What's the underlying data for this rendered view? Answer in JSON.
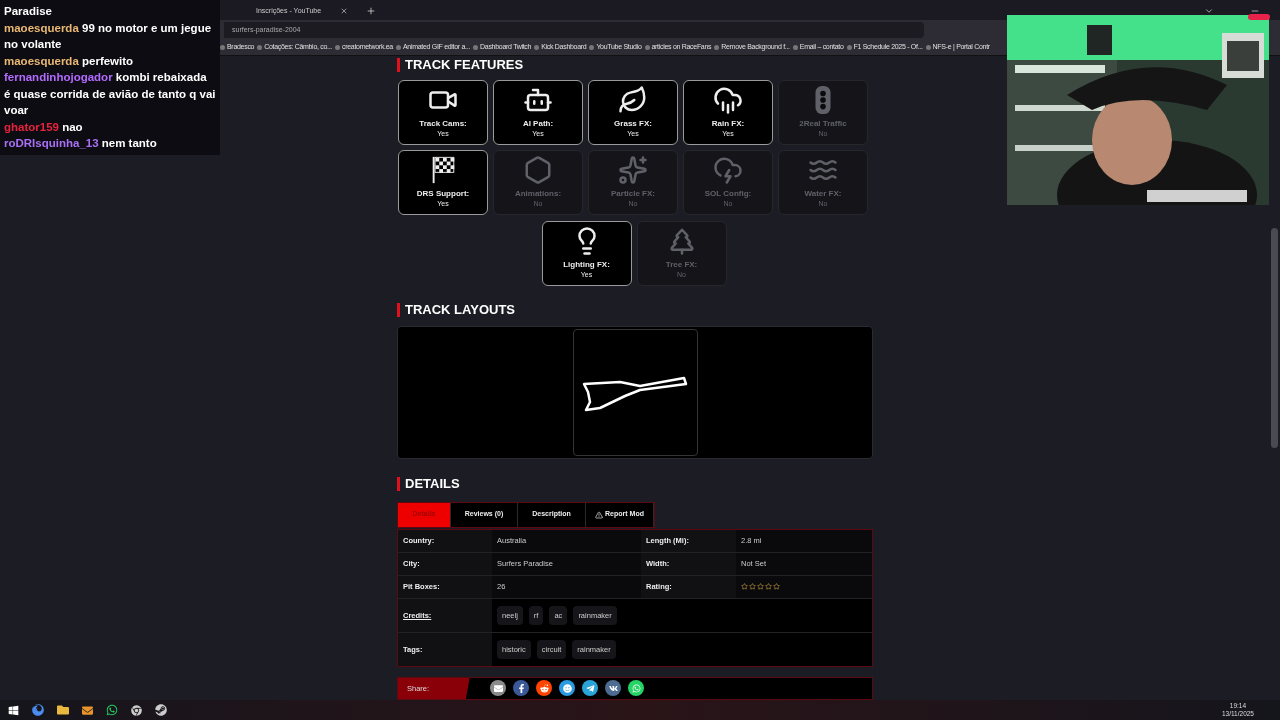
{
  "browser": {
    "tabs": [
      {
        "title": "Inscrições - YouTube",
        "selected": false
      }
    ],
    "address": "surfers-paradise-2004",
    "bookmarks": [
      "Bradesco",
      "Cotações: Câmbio, co...",
      "creatornetwork.ea",
      "Animated GIF editor a...",
      "Dashboard Twitch",
      "Kick Dashboard",
      "YouTube Studio",
      "articles on RaceFans",
      "Remove Background f...",
      "Email – contato",
      "F1 Schedule 2025 - Of...",
      "NFS-e | Portal Contr"
    ]
  },
  "chat": {
    "lead": "Paradise",
    "messages": [
      {
        "user": "maoesquerda",
        "color": "#e9b872",
        "text": "99 no motor e um jegue no volante"
      },
      {
        "user": "maoesquerda",
        "color": "#e9b872",
        "text": "perfewito"
      },
      {
        "user": "fernandinhojogador",
        "color": "#b36bff",
        "text": "kombi rebaixada é quase corrida de avião de tanto q vai voar"
      },
      {
        "user": "ghator159",
        "color": "#e8223d",
        "text": "nao"
      },
      {
        "user": "roDRIsquinha_13",
        "color": "#a970f5",
        "text": "nem tanto"
      }
    ]
  },
  "features": {
    "title": "TRACK FEATURES",
    "items": [
      {
        "kind": "camera",
        "label": "Track Cams:",
        "value": "Yes",
        "enabled": true
      },
      {
        "kind": "robot",
        "label": "AI Path:",
        "value": "Yes",
        "enabled": true
      },
      {
        "kind": "leaf",
        "label": "Grass FX:",
        "value": "Yes",
        "enabled": true
      },
      {
        "kind": "rain",
        "label": "Rain FX:",
        "value": "Yes",
        "enabled": true
      },
      {
        "kind": "traffic",
        "label": "2Real Traffic",
        "value": "No",
        "enabled": false
      },
      {
        "kind": "flag",
        "label": "DRS Support:",
        "value": "Yes",
        "enabled": true
      },
      {
        "kind": "dice",
        "label": "Animations:",
        "value": "No",
        "enabled": false
      },
      {
        "kind": "burst",
        "label": "Particle FX:",
        "value": "No",
        "enabled": false
      },
      {
        "kind": "storm",
        "label": "SOL Config:",
        "value": "No",
        "enabled": false
      },
      {
        "kind": "water",
        "label": "Water FX:",
        "value": "No",
        "enabled": false
      },
      {
        "kind": "bulb",
        "label": "Lighting FX:",
        "value": "Yes",
        "enabled": true
      },
      {
        "kind": "tree",
        "label": "Tree FX:",
        "value": "No",
        "enabled": false
      }
    ]
  },
  "layouts": {
    "title": "TRACK LAYOUTS"
  },
  "details": {
    "title": "DETAILS",
    "tabs": [
      {
        "label": "Details",
        "selected": true
      },
      {
        "label": "Reviews (0)",
        "selected": false
      },
      {
        "label": "Description",
        "selected": false
      },
      {
        "label": "Report Mod",
        "selected": false,
        "warning": true
      }
    ],
    "rows": [
      [
        {
          "label": "Country:",
          "value": "Australia"
        },
        {
          "label": "Length (Mi):",
          "value": "2.8 mi"
        }
      ],
      [
        {
          "label": "City:",
          "value": "Surfers Paradise"
        },
        {
          "label": "Width:",
          "value": "Not Set"
        }
      ],
      [
        {
          "label": "Pit Boxes:",
          "value": "26"
        },
        {
          "label": "Rating:",
          "stars": 0
        }
      ]
    ],
    "credits": {
      "label": "Credits:",
      "tags": [
        "neelj",
        "rf",
        "ac",
        "rainmaker"
      ]
    },
    "tags": {
      "label": "Tags:",
      "tags": [
        "historic",
        "circuit",
        "rainmaker"
      ]
    },
    "share": {
      "label": "Share:",
      "services": [
        {
          "kind": "email"
        },
        {
          "kind": "facebook"
        },
        {
          "kind": "reddit"
        },
        {
          "kind": "smile"
        },
        {
          "kind": "telegram"
        },
        {
          "kind": "vk"
        },
        {
          "kind": "whatsapp"
        }
      ]
    }
  },
  "taskbar": {
    "time": "19:14",
    "date": "13/11/2025"
  }
}
